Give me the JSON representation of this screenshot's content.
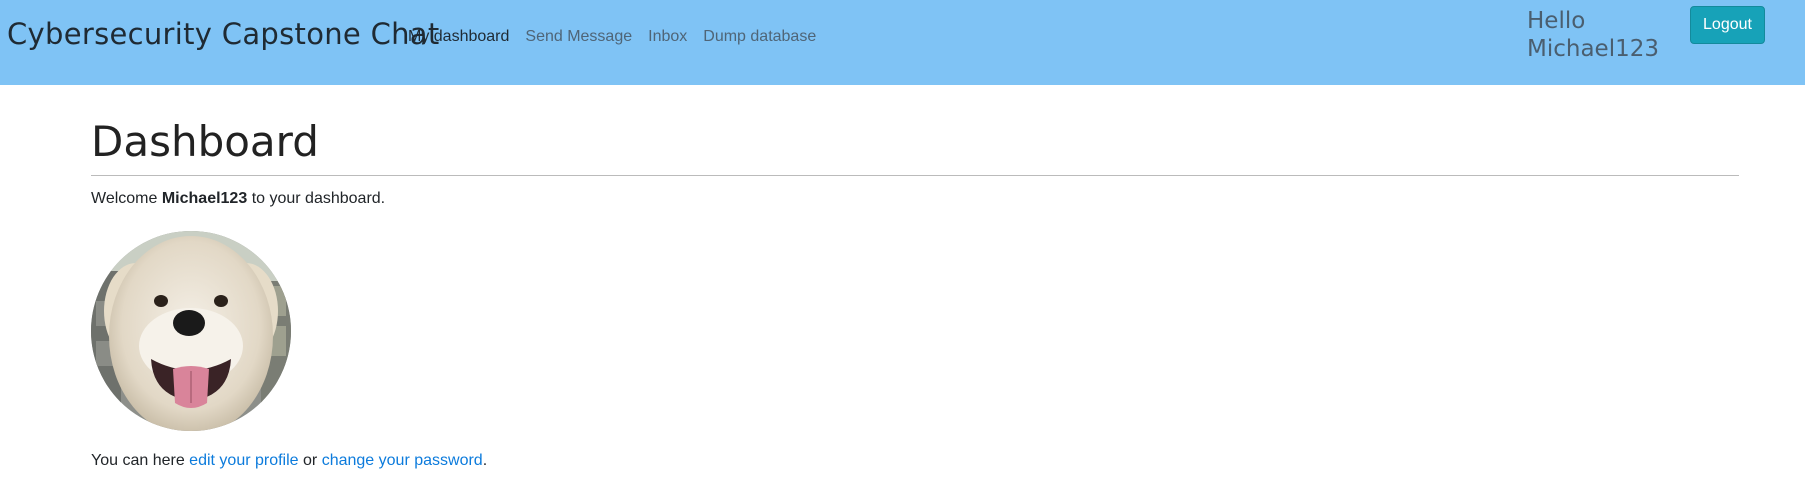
{
  "navbar": {
    "brand": "Cybersecurity Capstone Chat",
    "links": [
      {
        "label": "My dashboard",
        "active": true
      },
      {
        "label": "Send Message",
        "active": false
      },
      {
        "label": "Inbox",
        "active": false
      },
      {
        "label": "Dump database",
        "active": false
      }
    ],
    "greeting_line1": "Hello",
    "greeting_line2": "Michael123",
    "logout_label": "Logout"
  },
  "main": {
    "title": "Dashboard",
    "welcome_prefix": "Welcome",
    "username": "Michael123",
    "welcome_suffix": "to your dashboard.",
    "links_prefix": "You can here",
    "edit_profile_label": "edit your profile",
    "links_middle": "or",
    "change_password_label": "change your password",
    "links_suffix": "."
  },
  "colors": {
    "navbar_bg": "#7fc3f5",
    "logout_bg": "#17a2b8",
    "link": "#0c7bdc"
  },
  "icons": {
    "avatar": "profile-photo-dog"
  }
}
